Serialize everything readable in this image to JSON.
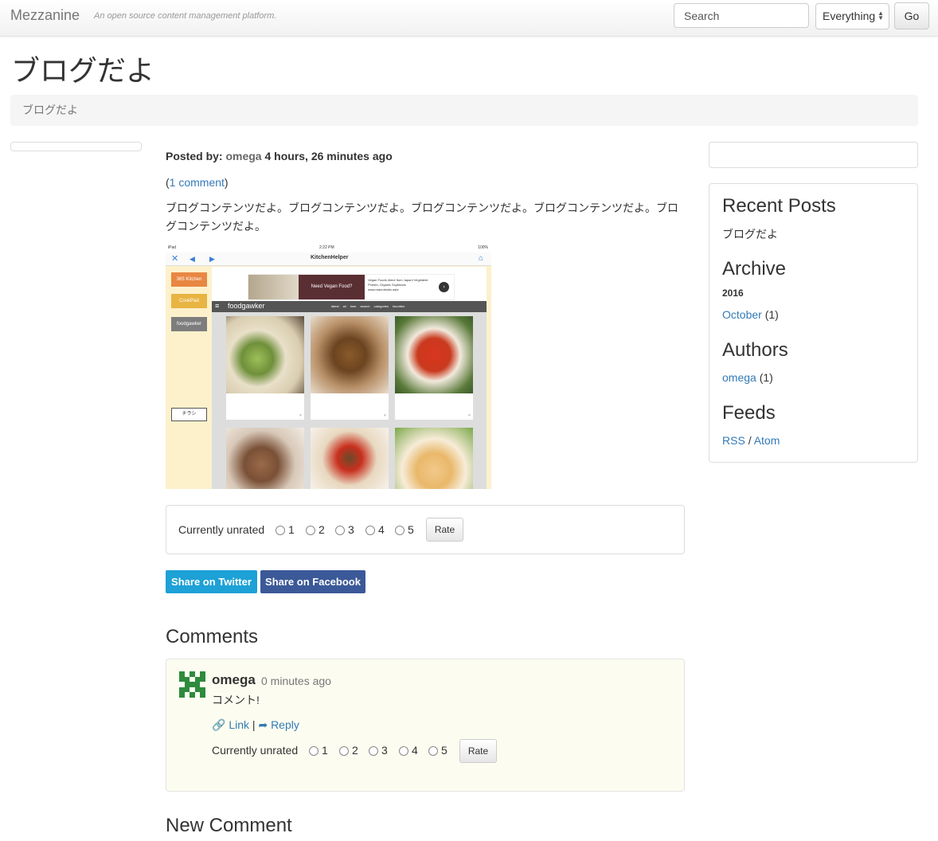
{
  "nav": {
    "brand": "Mezzanine",
    "tagline": "An open source content management platform.",
    "search_placeholder": "Search",
    "filter_selected": "Everything",
    "go_label": "Go"
  },
  "page": {
    "title": "ブログだよ",
    "breadcrumb": "ブログだよ"
  },
  "post": {
    "posted_by_label": "Posted by:",
    "author": "omega",
    "time_ago": "4 hours, 26 minutes ago",
    "comments_link": "1 comment",
    "body": "ブログコンテンツだよ。ブログコンテンツだよ。ブログコンテンツだよ。ブログコンテンツだよ。ブログコンテンツだよ。"
  },
  "screenshot": {
    "device": "iPad",
    "clock": "2:22 PM",
    "battery": "100%",
    "app_title": "KitchenHelper",
    "sidebar_buttons": [
      "365 Kitchen",
      "CookPad",
      "foodgawker"
    ],
    "flyer_button": "チラシ",
    "ad_text": "Need Vegan Food?",
    "ad_desc": "Vegan Foods direct from Japan! Vegetable Protein, Organic Soybeans",
    "ad_url": "www.macrobiotic.asia",
    "site_logo": "foodgawker",
    "site_links": "latest all time search categories favorites"
  },
  "rating": {
    "label": "Currently unrated",
    "options": [
      "1",
      "2",
      "3",
      "4",
      "5"
    ],
    "button": "Rate"
  },
  "share": {
    "twitter": "Share on Twitter",
    "facebook": "Share on Facebook"
  },
  "comments": {
    "heading": "Comments",
    "items": [
      {
        "author": "omega",
        "time": "0 minutes ago",
        "body": "コメント!",
        "link_label": "Link",
        "separator": "|",
        "reply_label": "Reply",
        "rating_label": "Currently unrated",
        "rate_button": "Rate"
      }
    ],
    "new_heading": "New Comment"
  },
  "sidebar": {
    "recent_heading": "Recent Posts",
    "recent_posts": [
      "ブログだよ"
    ],
    "archive_heading": "Archive",
    "archive_year": "2016",
    "archive_month": "October",
    "archive_count": "(1)",
    "authors_heading": "Authors",
    "author_name": "omega",
    "author_count": "(1)",
    "feeds_heading": "Feeds",
    "rss": "RSS",
    "feeds_sep": "/",
    "atom": "Atom"
  },
  "colors": {
    "link": "#337ab7",
    "twitter": "#1da1d6",
    "facebook": "#3b5998",
    "comment_bg": "#fcfdf0",
    "avatar": "#2e8b3d"
  }
}
